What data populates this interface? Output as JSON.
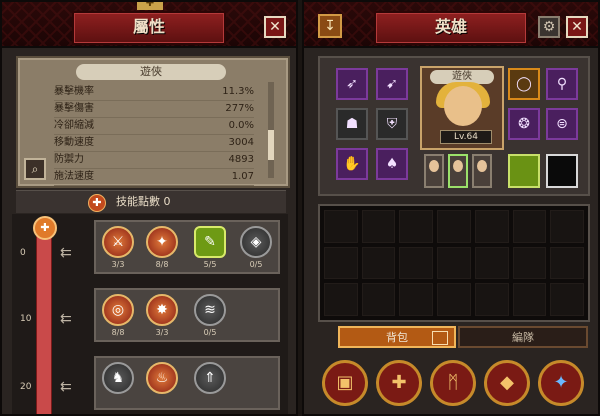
{
  "left_panel": {
    "title": "屬性",
    "class_name": "遊俠",
    "stats": [
      {
        "label": "暴擊機率",
        "value": "11.3%"
      },
      {
        "label": "暴擊傷害",
        "value": "277%"
      },
      {
        "label": "冷卻縮減",
        "value": "0.0%"
      },
      {
        "label": "移動速度",
        "value": "3004"
      },
      {
        "label": "防禦力",
        "value": "4893"
      },
      {
        "label": "施法速度",
        "value": "1.07"
      }
    ],
    "skill_points_label": "技能點數 0",
    "tier_levels": [
      "0",
      "10",
      "20"
    ],
    "skill_rows": [
      {
        "counts": [
          "3/3",
          "8/8",
          "5/5",
          "0/5"
        ]
      },
      {
        "counts": [
          "8/8",
          "3/3",
          "0/5"
        ]
      },
      {
        "counts": [
          "",
          "",
          ""
        ]
      }
    ]
  },
  "right_panel": {
    "title": "英雄",
    "class_name": "遊俠",
    "level": "Lv.64",
    "tabs": [
      "背包",
      "編隊"
    ],
    "bottom_icons": [
      "chest-icon",
      "cross-icon",
      "m-emblem-icon",
      "cube-icon",
      "gem-icon"
    ]
  },
  "colors": {
    "accent_red": "#8f2020",
    "banner_text": "#f0e0c8",
    "rail_red": "#c94a4a",
    "tab_active": "#b35a14"
  }
}
